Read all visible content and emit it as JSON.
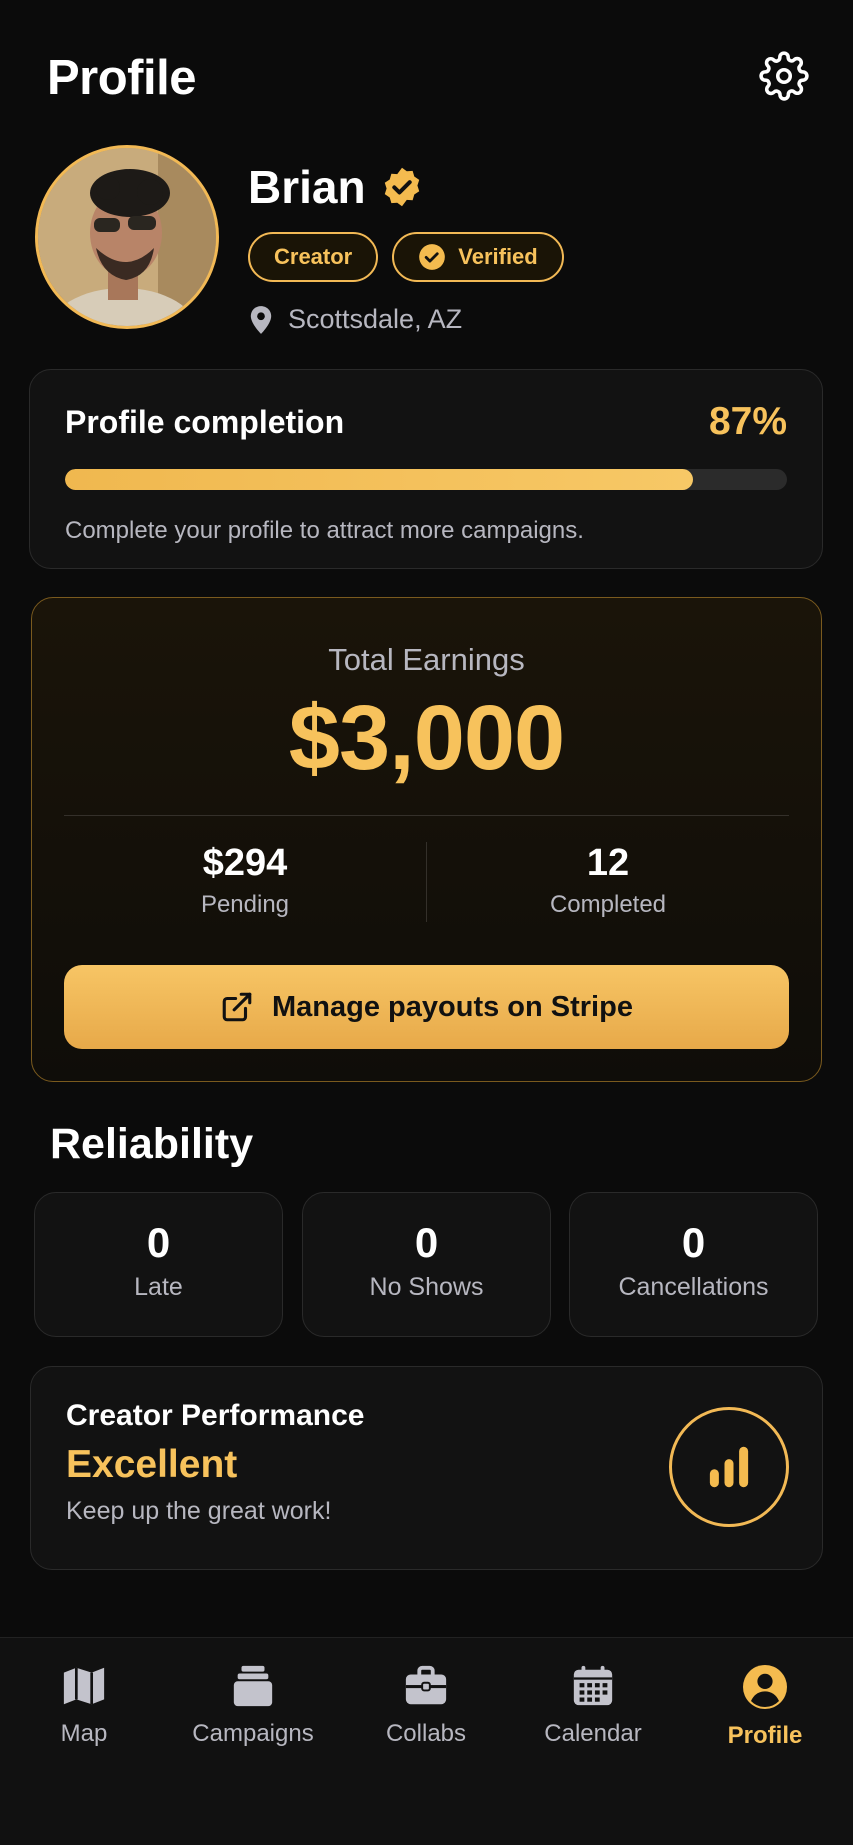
{
  "header": {
    "title": "Profile",
    "settings_icon": "gear-icon"
  },
  "profile": {
    "name": "Brian",
    "chips": {
      "creator": "Creator",
      "verified": "Verified"
    },
    "location": "Scottsdale, AZ"
  },
  "completion": {
    "title": "Profile completion",
    "percent_text": "87%",
    "percent": 87,
    "subtitle": "Complete your profile to attract more campaigns."
  },
  "earnings": {
    "label": "Total Earnings",
    "total": "$3,000",
    "pending_value": "$294",
    "pending_label": "Pending",
    "completed_value": "12",
    "completed_label": "Completed",
    "button_label": "Manage payouts on Stripe"
  },
  "reliability": {
    "title": "Reliability",
    "items": [
      {
        "value": "0",
        "label": "Late"
      },
      {
        "value": "0",
        "label": "No Shows"
      },
      {
        "value": "0",
        "label": "Cancellations"
      }
    ]
  },
  "performance": {
    "title": "Creator Performance",
    "value": "Excellent",
    "subtitle": "Keep up the great work!"
  },
  "tabs": [
    {
      "label": "Map",
      "icon": "map-icon"
    },
    {
      "label": "Campaigns",
      "icon": "stack-icon"
    },
    {
      "label": "Collabs",
      "icon": "briefcase-icon"
    },
    {
      "label": "Calendar",
      "icon": "calendar-icon"
    },
    {
      "label": "Profile",
      "icon": "user-icon"
    }
  ],
  "colors": {
    "accent": "#f7c25c",
    "background": "#0b0b0b",
    "card": "#121212"
  }
}
